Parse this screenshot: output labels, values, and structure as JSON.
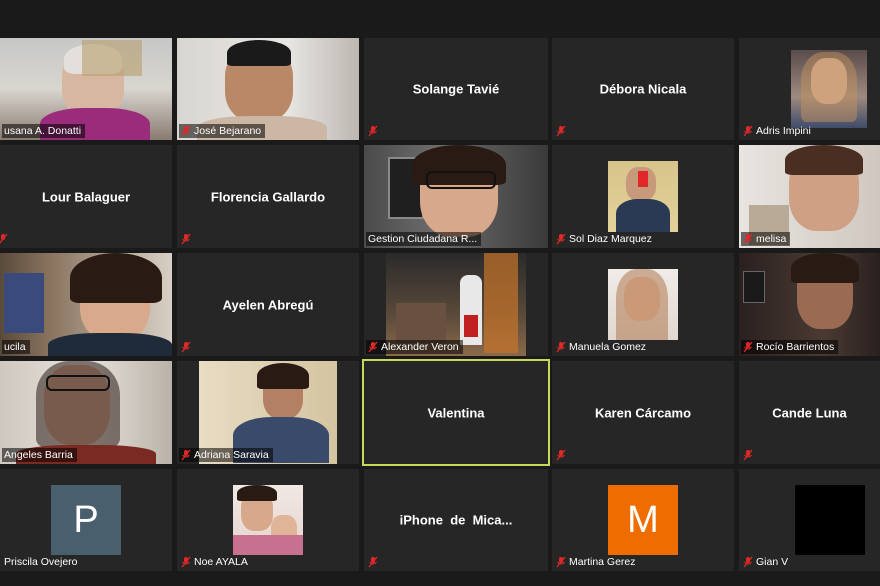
{
  "participants": [
    {
      "name": "Susana A. Donatti",
      "caption": "usana A. Donatti",
      "muted": false
    },
    {
      "name": "José Bejarano",
      "caption": "José Bejarano",
      "muted": true
    },
    {
      "name": "Solange Tavié",
      "center": "Solange Tavié",
      "muted": true
    },
    {
      "name": "Débora Nicala",
      "center": "Débora Nicala",
      "muted": true
    },
    {
      "name": "Adris Impini",
      "caption": "Adris Impini",
      "muted": true
    },
    {
      "name": "Lour Balaguer",
      "center": "Lour Balaguer",
      "muted": true
    },
    {
      "name": "Florencia Gallardo",
      "center": "Florencia Gallardo",
      "muted": true
    },
    {
      "name": "Gestion Ciudadana R...",
      "caption": "Gestion Ciudadana R...",
      "muted": false
    },
    {
      "name": "Sol Diaz Marquez",
      "caption": "Sol Diaz Marquez",
      "muted": true
    },
    {
      "name": "melisa",
      "caption": "melisa",
      "muted": true
    },
    {
      "name": "Lucila",
      "caption": "ucila",
      "muted": false
    },
    {
      "name": "Ayelen Abregú",
      "center": "Ayelen Abregú",
      "muted": true
    },
    {
      "name": "Alexander Veron",
      "caption": "Alexander Veron",
      "muted": true
    },
    {
      "name": "Manuela Gomez",
      "caption": "Manuela Gomez",
      "muted": true
    },
    {
      "name": "Rocío Barrientos",
      "caption": "Rocío Barrientos",
      "muted": true
    },
    {
      "name": "Angeles Barria",
      "caption": "Angeles Barria",
      "muted": false
    },
    {
      "name": "Adriana Saravia",
      "caption": "Adriana Saravia",
      "muted": true
    },
    {
      "name": "Valentina",
      "center": "Valentina",
      "muted": false,
      "active": true
    },
    {
      "name": "Karen Cárcamo",
      "center": "Karen Cárcamo",
      "muted": true
    },
    {
      "name": "Cande Luna",
      "center": "Cande Luna",
      "muted": true
    },
    {
      "name": "Priscila Ovejero",
      "caption": "Priscila Ovejero",
      "muted": false,
      "avatar": "P"
    },
    {
      "name": "Noe AYALA",
      "caption": "Noe AYALA",
      "muted": true
    },
    {
      "name": "iPhone de Mica...",
      "center": "iPhone  de  Mica...",
      "muted": true
    },
    {
      "name": "Martina Gerez",
      "caption": "Martina Gerez",
      "muted": true,
      "avatar": "M"
    },
    {
      "name": "Gian V",
      "caption": "Gian V",
      "muted": true
    }
  ],
  "colors": {
    "tile_bg": "#262626",
    "active_border": "#c8d95a",
    "muted_icon": "#e02828",
    "avatar_P": "#4a5f6e",
    "avatar_M": "#ef6c00"
  }
}
